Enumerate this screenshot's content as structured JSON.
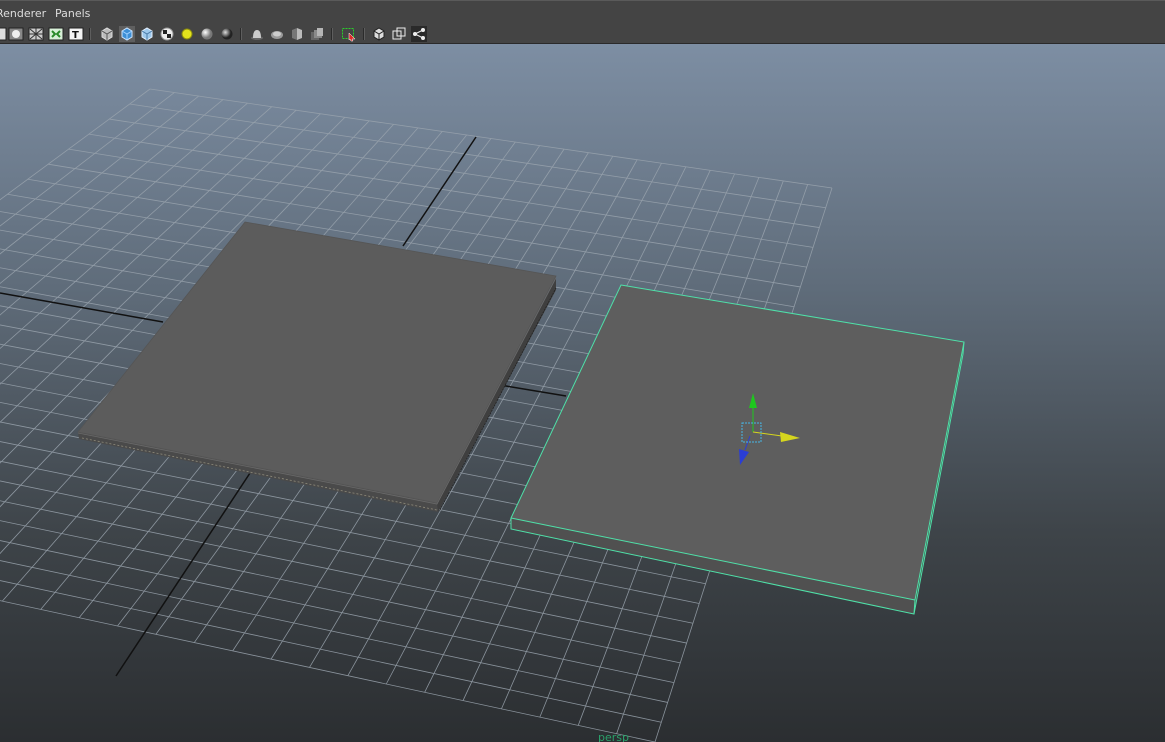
{
  "menubar": {
    "items": [
      {
        "label": "Renderer"
      },
      {
        "label": "Panels"
      }
    ]
  },
  "toolbar": {
    "icons": [
      "wireframe-icon",
      "smooth-shade-icon",
      "wireframe-on-shaded-icon",
      "default-quality-icon",
      "textured-icon",
      "use-default-material-icon",
      "shaded-cube-icon",
      "xray-cube-icon",
      "checker-texture-icon",
      "default-light-icon",
      "all-lights-icon",
      "active-light-icon",
      "shadows-icon",
      "ambient-occlusion-icon",
      "antialias-icon",
      "depth-of-field-icon",
      "isolate-select-icon",
      "xray-joints-icon",
      "xray-active-components-icon",
      "gate-mask-icon"
    ]
  },
  "viewport": {
    "camera_label": "persp",
    "selection_color": "#4fe0a8",
    "background_top": "#7d8ea3",
    "background_bottom": "#2b2e31",
    "grid_color": "#9aa4ae",
    "axis_color": "#111111",
    "objects": [
      {
        "name": "plane-left",
        "selected": false,
        "color": "#5c5c5c"
      },
      {
        "name": "plane-right",
        "selected": true,
        "color": "#5e5e5e"
      }
    ],
    "manipulator": {
      "x_axis_color": "#d6d61e",
      "y_axis_color": "#1ec81e",
      "z_axis_color": "#2a3ed6"
    }
  }
}
